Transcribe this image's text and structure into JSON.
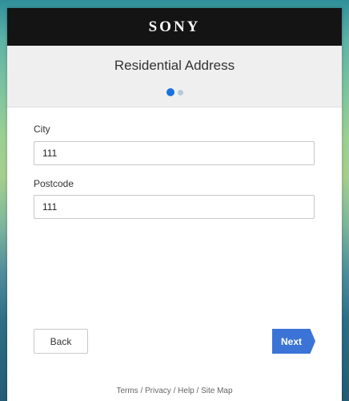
{
  "brand": {
    "logo_text": "SONY"
  },
  "header": {
    "title": "Residential Address",
    "steps": {
      "total": 2,
      "current": 1
    }
  },
  "form": {
    "city": {
      "label": "City",
      "value": "111"
    },
    "postcode": {
      "label": "Postcode",
      "value": "111"
    }
  },
  "actions": {
    "back_label": "Back",
    "next_label": "Next"
  },
  "footer": {
    "links": [
      "Terms",
      "Privacy",
      "Help",
      "Site Map"
    ],
    "separator": " / "
  },
  "colors": {
    "brand_bar": "#141414",
    "accent": "#3b74d6",
    "step_active": "#1a73d9",
    "step_inactive": "#b5c9dd"
  }
}
